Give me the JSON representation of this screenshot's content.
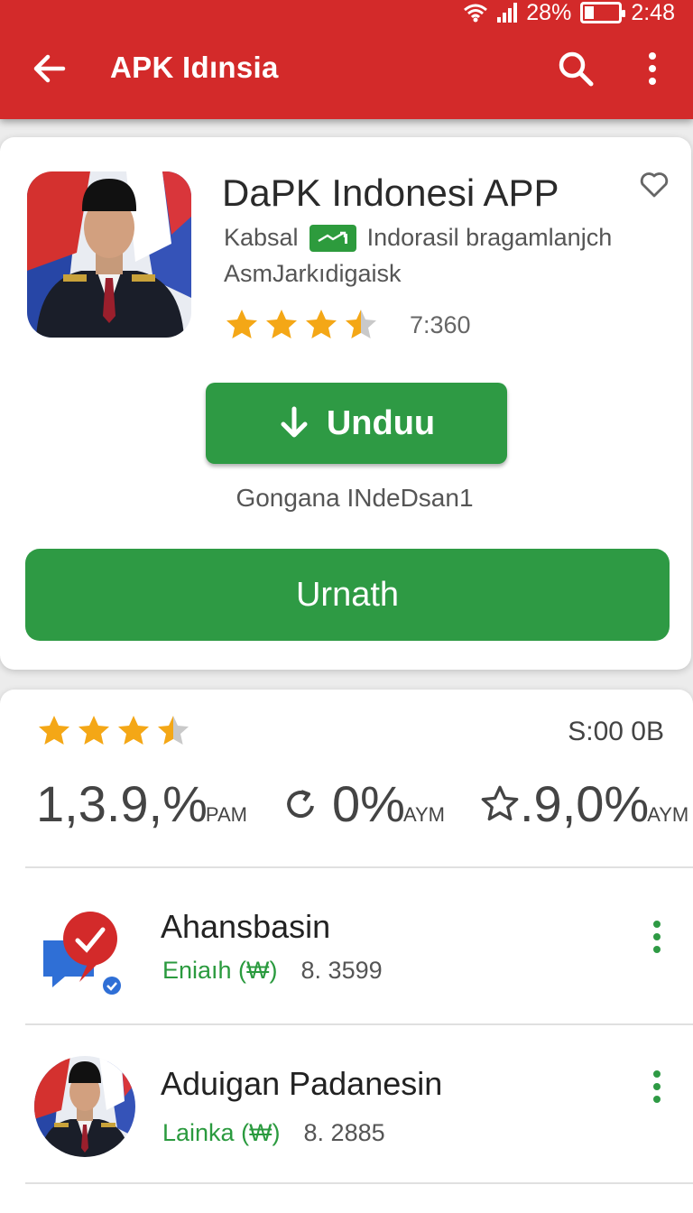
{
  "status_bar": {
    "battery": "28%",
    "time": "2:48",
    "battery_level": 0.28
  },
  "toolbar": {
    "title": "APK Idınsia"
  },
  "app": {
    "name": "DaPK Indonesi  APP",
    "developer": "Kabsal",
    "description": "Indorasil bragamlanjch",
    "category": "AsmJarkıdigaisk",
    "rating": 3.5,
    "rating_count": "7:360",
    "download_label": "Unduu",
    "download_caption": "Gongana INdeDsan1",
    "install_label": "Urnath"
  },
  "stats": {
    "rating": 3.5,
    "size": "S:00 0B",
    "items": [
      {
        "value": "1,3.9,%",
        "unit": "PAM"
      },
      {
        "value": "0%",
        "unit": "AYM",
        "icon": "refresh-icon"
      },
      {
        "value": ".9,0%",
        "unit": "AYM",
        "icon": "star-outline-icon"
      }
    ]
  },
  "related": [
    {
      "title": "Ahansbasin",
      "developer": "Eniaıh (₩)",
      "count": "8. 3599",
      "icon": "chat-check-icon"
    },
    {
      "title": "Aduigan Padanesin",
      "developer": "Lainka (₩)",
      "count": "8. 2885",
      "icon": "person-avatar-icon"
    }
  ],
  "colors": {
    "app_bar": "#d32a2a",
    "accent_green": "#2e9a44",
    "star": "#f4a716"
  }
}
